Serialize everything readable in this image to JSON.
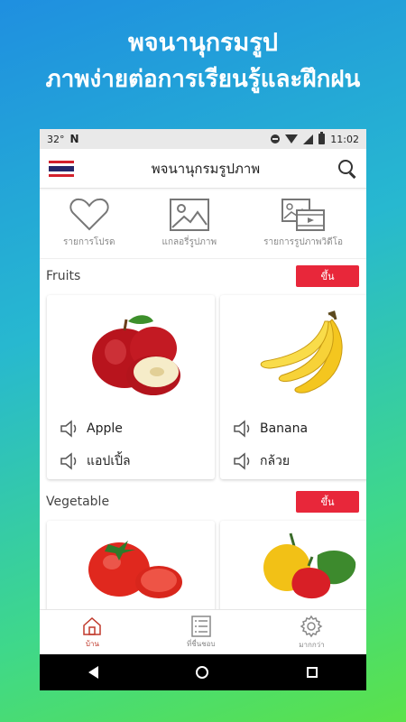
{
  "promo": {
    "line1": "พจนานุกรมรูป",
    "line2": "ภาพง่ายต่อการเรียนรู้และฝึกฝน"
  },
  "status_bar": {
    "temperature": "32°",
    "time": "11:02"
  },
  "app_bar": {
    "title": "พจนานุกรมรูปภาพ"
  },
  "quick_actions": [
    {
      "label": "รายการโปรด",
      "icon": "heart-icon"
    },
    {
      "label": "แกลอรี่รูปภาพ",
      "icon": "image-gallery-icon"
    },
    {
      "label": "รายการรูปภาพวิดีโอ",
      "icon": "video-gallery-icon"
    }
  ],
  "sections": [
    {
      "name": "Fruits",
      "button_label": "ขึ้น",
      "cards": [
        {
          "english": "Apple",
          "thai": "แอปเปิ้ล",
          "image": "apple"
        },
        {
          "english": "Banana",
          "thai": "กล้วย",
          "image": "banana"
        }
      ]
    },
    {
      "name": "Vegetable",
      "button_label": "ขึ้น",
      "cards": [
        {
          "image": "tomato"
        },
        {
          "image": "bell-pepper"
        }
      ]
    }
  ],
  "bottom_nav": [
    {
      "label": "บ้าน",
      "icon": "home-icon",
      "active": true
    },
    {
      "label": "ที่ชื่นชอบ",
      "icon": "list-icon",
      "active": false
    },
    {
      "label": "มากกว่า",
      "icon": "gear-icon",
      "active": false
    }
  ],
  "colors": {
    "accent_red": "#e8273a",
    "gradient_top": "#1f8fe0",
    "gradient_bottom": "#5be24a"
  }
}
